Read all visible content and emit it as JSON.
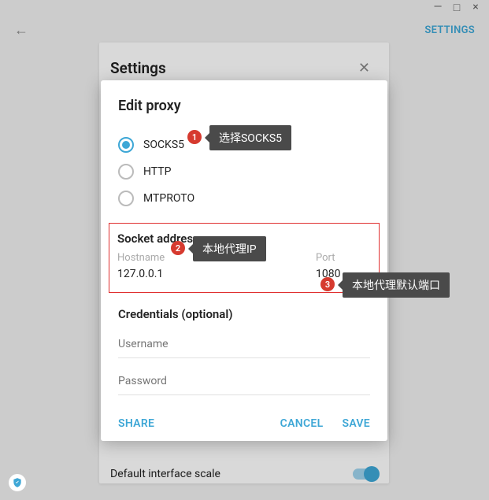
{
  "window": {
    "minimize": "—",
    "maximize": "□",
    "close": "×"
  },
  "header": {
    "settings_link": "SETTINGS"
  },
  "bg_panel": {
    "title": "Settings",
    "toggle_label": "Default interface scale"
  },
  "dialog": {
    "title": "Edit proxy",
    "radios": {
      "socks5": "SOCKS5",
      "http": "HTTP",
      "mtproto": "MTPROTO"
    },
    "socket": {
      "title": "Socket address",
      "hostname_label": "Hostname",
      "hostname_value": "127.0.0.1",
      "port_label": "Port",
      "port_value": "1080"
    },
    "credentials": {
      "title": "Credentials (optional)",
      "username_placeholder": "Username",
      "password_placeholder": "Password"
    },
    "buttons": {
      "share": "SHARE",
      "cancel": "CANCEL",
      "save": "SAVE"
    }
  },
  "annotations": {
    "b1": "1",
    "t1": "选择SOCKS5",
    "b2": "2",
    "t2": "本地代理IP",
    "b3": "3",
    "t3": "本地代理默认端口"
  }
}
